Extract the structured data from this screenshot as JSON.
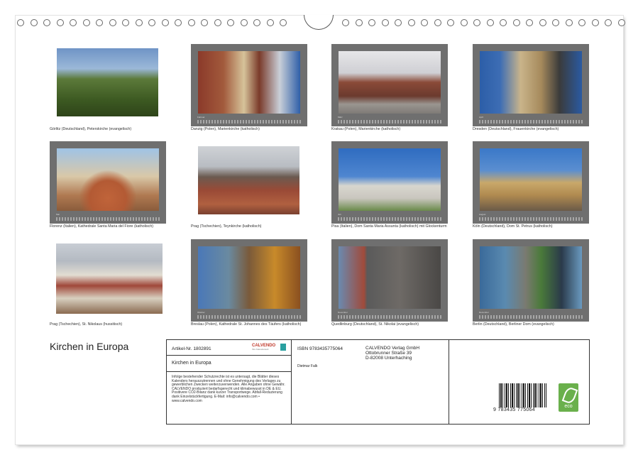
{
  "calendar_title": "Kirchen in Europa",
  "photos": [
    {
      "caption": "Görlitz (Deutschland), Peterskirche (evangelisch)",
      "month": ""
    },
    {
      "caption": "Danzig (Polen), Marienkirche (katholisch)",
      "month": "Februar"
    },
    {
      "caption": "Krakau (Polen), Marienkirche (katholisch)",
      "month": "März"
    },
    {
      "caption": "Dresden (Deutschland), Frauenkirche (evangelisch)",
      "month": "April"
    },
    {
      "caption": "Florenz (Italien), Kathedrale Santa Maria del Fiore (katholisch)",
      "month": "Mai"
    },
    {
      "caption": "Prag (Tschechien), Teynkirche (katholisch)",
      "month": ""
    },
    {
      "caption": "Pisa (Italien), Dom Santa Maria Assunta (katholisch) mit Glockenturm",
      "month": "Juli"
    },
    {
      "caption": "Köln (Deutschland), Dom St. Petrus (katholisch)",
      "month": "August"
    },
    {
      "caption": "Prag (Tschechien), St. Nikolaus (hussitisch)",
      "month": ""
    },
    {
      "caption": "Breslau (Polen), Kathedrale St. Johannes des Täufers (katholisch)",
      "month": "Oktober"
    },
    {
      "caption": "Quedlinburg (Deutschland), St. Nikolai (evangelisch)",
      "month": "November"
    },
    {
      "caption": "Berlin (Deutschland), Berliner Dom (evangelisch)",
      "month": "Dezember"
    }
  ],
  "imprint": {
    "article_no": "Artikel-Nr. 1802891",
    "logo_text": "CALVENDO",
    "logo_sub": "Ihre Kalenderwelt",
    "title": "Kirchen in Europa",
    "legal": "Infolge bestehender Schutzrechte ist es untersagt, die Blätter dieses Kalenders herauszutrennen und ohne Genehmigung des Verlages zu gewerblichen Zwecken weiterzuverwenden. Alle Angaben ohne Gewähr. CALVENDO produziert bedarfsgerecht und klimabewusst in DE & EU. Positivere CO2-Bilanz dank kurzer Transportwege. Abfall-Reduzierung dank Einzelstückfertigung. E-Mail: info@calvendo.com • www.calvendo.com",
    "isbn": "ISBN 9783435775064",
    "publisher_line1": "CALVENDO Verlag GmbH",
    "publisher_line2": "Ottobrunner Straße 39",
    "publisher_line3": "D-82008 Unterhaching",
    "author": "Dietmar Falk",
    "barcode_number": "9 783435 775064",
    "eco_label": "eco"
  }
}
